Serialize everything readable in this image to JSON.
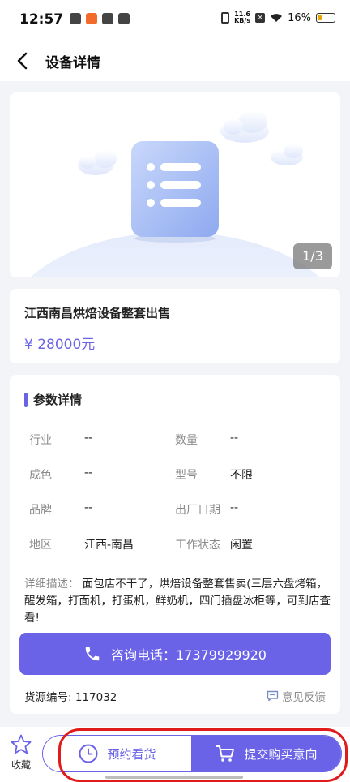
{
  "status_bar": {
    "time": "12:57",
    "net_speed_value": "11.6",
    "net_speed_unit": "KB/s",
    "battery": "16%"
  },
  "nav": {
    "title": "设备详情",
    "back_icon": "chevron-left-icon"
  },
  "gallery": {
    "indicator": "1/3",
    "current": 1,
    "total": 3
  },
  "product": {
    "title": "江西南昌烘焙设备整套出售",
    "price": "¥ 28000元"
  },
  "params": {
    "section_title": "参数详情",
    "rows": [
      [
        {
          "label": "行业",
          "value": "--"
        },
        {
          "label": "数量",
          "value": "--"
        }
      ],
      [
        {
          "label": "成色",
          "value": "--"
        },
        {
          "label": "型号",
          "value": "不限"
        }
      ],
      [
        {
          "label": "品牌",
          "value": "--"
        },
        {
          "label": "出厂日期",
          "value": "--"
        }
      ],
      [
        {
          "label": "地区",
          "value": "江西-南昌"
        },
        {
          "label": "工作状态",
          "value": "闲置"
        }
      ]
    ],
    "description_label": "详细描述：",
    "description": "面包店不干了，烘焙设备整套售卖(三层六盘烤箱，醒发箱，打面机，打蛋机，鲜奶机，四门插盘冰柜等，可到店查看!"
  },
  "call_button": {
    "label": "咨询电话：17379929920"
  },
  "source": {
    "number": "货源编号: 117032",
    "feedback": "意见反馈"
  },
  "bottom": {
    "favorite": "收藏",
    "appointment": "预约看货",
    "submit": "提交购买意向"
  },
  "colors": {
    "accent": "#6a63e8",
    "highlight": "#e01b1b"
  }
}
